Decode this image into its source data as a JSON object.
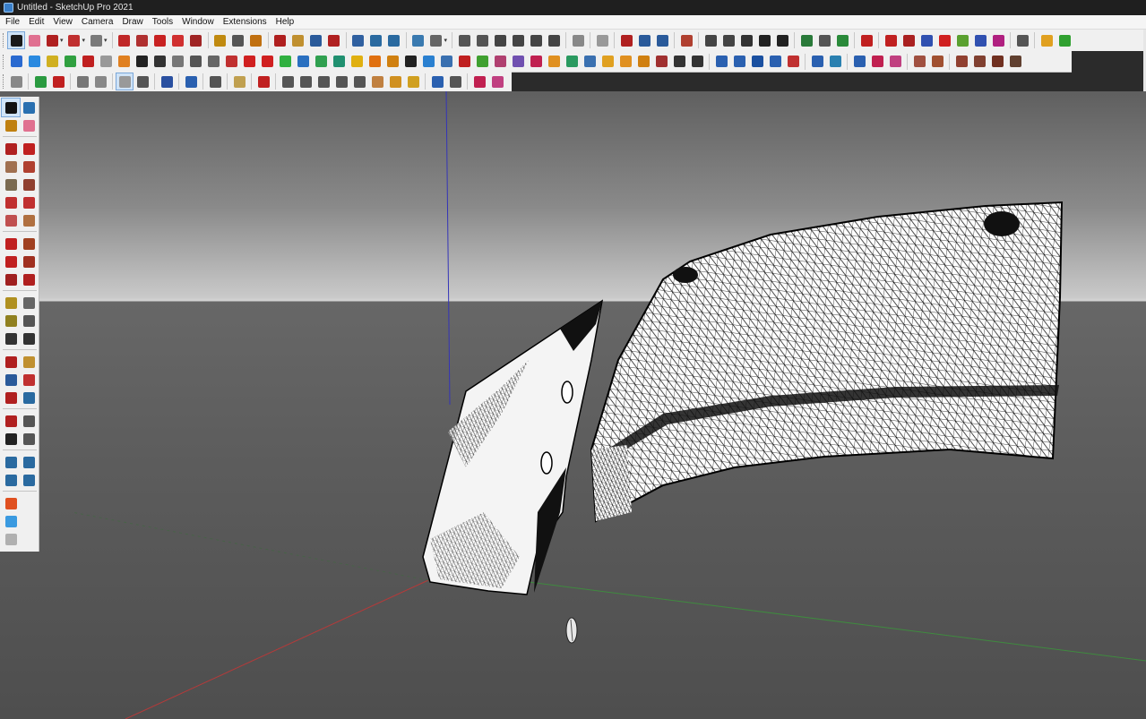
{
  "window": {
    "title": "Untitled - SketchUp Pro 2021"
  },
  "menu": [
    "File",
    "Edit",
    "View",
    "Camera",
    "Draw",
    "Tools",
    "Window",
    "Extensions",
    "Help"
  ],
  "colors": {
    "red_axis": "#b43a3a",
    "green_axis": "#3f8a3f",
    "blue_axis": "#3434b8",
    "selection": "#cfe3f7"
  },
  "toolbars": {
    "row1": [
      {
        "icon": "select-icon",
        "c": "#1a1a1a",
        "sel": true
      },
      {
        "icon": "eraser-icon",
        "c": "#e07090"
      },
      {
        "icon": "line-icon",
        "c": "#b02020",
        "drop": true
      },
      {
        "icon": "arc-icon",
        "c": "#c03030",
        "drop": true
      },
      {
        "icon": "circle-shape-icon",
        "c": "#7a7a7a",
        "drop": true
      },
      {
        "sep": true
      },
      {
        "icon": "move-icon",
        "c": "#c02828"
      },
      {
        "icon": "follow-me-icon",
        "c": "#b03030"
      },
      {
        "icon": "push-pull-icon",
        "c": "#c82222"
      },
      {
        "icon": "rotate-icon",
        "c": "#d03030"
      },
      {
        "icon": "scale-icon",
        "c": "#a02525"
      },
      {
        "sep": true
      },
      {
        "icon": "tape-measure-icon",
        "c": "#c08a10"
      },
      {
        "icon": "text-icon",
        "c": "#555"
      },
      {
        "icon": "paint-bucket-icon",
        "c": "#c07010"
      },
      {
        "sep": true
      },
      {
        "icon": "orbit-icon",
        "c": "#b02020"
      },
      {
        "icon": "pan-icon",
        "c": "#c09030"
      },
      {
        "icon": "zoom-icon",
        "c": "#2a5a9a"
      },
      {
        "icon": "zoom-extents-icon",
        "c": "#b02020"
      },
      {
        "sep": true
      },
      {
        "icon": "warehouse-icon",
        "c": "#3060a0"
      },
      {
        "icon": "extension-warehouse-icon",
        "c": "#2a6aa0"
      },
      {
        "icon": "share-model-icon",
        "c": "#2a6aa0"
      },
      {
        "sep": true
      },
      {
        "icon": "sandbox-icon",
        "c": "#3a7ab0"
      },
      {
        "icon": "search-icon",
        "c": "#666",
        "drop": true
      },
      {
        "sep": true
      },
      {
        "icon": "iso-view-icon",
        "c": "#555"
      },
      {
        "icon": "top-view-icon",
        "c": "#555"
      },
      {
        "icon": "front-view-icon",
        "c": "#444"
      },
      {
        "icon": "right-view-icon",
        "c": "#444"
      },
      {
        "icon": "back-view-icon",
        "c": "#444"
      },
      {
        "icon": "left-view-icon",
        "c": "#444"
      },
      {
        "sep": true
      },
      {
        "icon": "xray-icon",
        "c": "#888"
      },
      {
        "sep": true
      },
      {
        "icon": "back-edges-icon",
        "c": "#999"
      },
      {
        "sep": true
      },
      {
        "icon": "section-plane-icon",
        "c": "#b02020"
      },
      {
        "icon": "section-cut-icon",
        "c": "#2a5a9a"
      },
      {
        "icon": "section-fill-icon",
        "c": "#2a5a9a"
      },
      {
        "sep": true
      },
      {
        "icon": "component-icon",
        "c": "#b04030"
      },
      {
        "sep": true
      },
      {
        "icon": "person-icon",
        "c": "#444"
      },
      {
        "icon": "person-walk-icon",
        "c": "#444"
      },
      {
        "icon": "camera-icon",
        "c": "#333"
      },
      {
        "icon": "fog-icon",
        "c": "#222"
      },
      {
        "icon": "gear-icon",
        "c": "#222"
      },
      {
        "sep": true
      },
      {
        "icon": "geo-location-icon",
        "c": "#2a7a3a"
      },
      {
        "icon": "report-icon",
        "c": "#555"
      },
      {
        "icon": "link-icon",
        "c": "#2a8a3a"
      },
      {
        "sep": true
      },
      {
        "icon": "undo-icon",
        "c": "#c02020"
      },
      {
        "sep": true
      },
      {
        "icon": "solid-union-icon",
        "c": "#c02020"
      },
      {
        "icon": "solid-subtract-icon",
        "c": "#aa2020"
      },
      {
        "icon": "solid-intersect-icon",
        "c": "#3050b0"
      },
      {
        "icon": "solid-trim-icon",
        "c": "#d02020"
      },
      {
        "icon": "solid-split-icon",
        "c": "#5aa030"
      },
      {
        "icon": "solid-shell-icon",
        "c": "#3050b0"
      },
      {
        "icon": "solid-outer-icon",
        "c": "#b02080"
      },
      {
        "sep": true
      },
      {
        "icon": "curviloft-icon",
        "c": "#555"
      },
      {
        "sep": true
      },
      {
        "icon": "shirt-icon",
        "c": "#e0a020"
      },
      {
        "icon": "shirt-green-icon",
        "c": "#30a030"
      }
    ],
    "row2": [
      {
        "icon": "tool-blue-1-icon",
        "c": "#2a6ad0"
      },
      {
        "icon": "tool-blue-2-icon",
        "c": "#2a8ae0"
      },
      {
        "icon": "tool-yellow-1-icon",
        "c": "#d0b020"
      },
      {
        "icon": "tool-green-1-icon",
        "c": "#30a040"
      },
      {
        "icon": "tool-red-1-icon",
        "c": "#c02020"
      },
      {
        "icon": "tool-outline-icon",
        "c": "#999"
      },
      {
        "icon": "tool-orange-icon",
        "c": "#e08020"
      },
      {
        "icon": "tool-black-1-icon",
        "c": "#222"
      },
      {
        "icon": "tool-black-2-icon",
        "c": "#333"
      },
      {
        "icon": "tool-flag-icon",
        "c": "#777"
      },
      {
        "icon": "tool-curve-1-icon",
        "c": "#555"
      },
      {
        "icon": "tool-curve-2-icon",
        "c": "#666"
      },
      {
        "icon": "tool-curve-3-icon",
        "c": "#c03030"
      },
      {
        "icon": "tool-red-2-icon",
        "c": "#d02020"
      },
      {
        "icon": "tool-cross-icon",
        "c": "#d02020"
      },
      {
        "icon": "tool-green-2-icon",
        "c": "#30b040"
      },
      {
        "icon": "tool-blue-3-icon",
        "c": "#2a70c0"
      },
      {
        "icon": "tool-green-3-icon",
        "c": "#30a050"
      },
      {
        "icon": "tool-teal-icon",
        "c": "#209070"
      },
      {
        "icon": "tool-warning-icon",
        "c": "#e0b010"
      },
      {
        "icon": "tool-orange-2-icon",
        "c": "#e07010"
      },
      {
        "icon": "tool-orange-3-icon",
        "c": "#d08010"
      },
      {
        "icon": "tool-black-3-icon",
        "c": "#222"
      },
      {
        "icon": "tool-blue-4-icon",
        "c": "#2a80d0"
      },
      {
        "icon": "tool-blue-5-icon",
        "c": "#3a70b0"
      },
      {
        "icon": "tool-red-3-icon",
        "c": "#c02020"
      },
      {
        "icon": "tool-green-4-icon",
        "c": "#40a030"
      },
      {
        "icon": "tool-multi-1-icon",
        "c": "#b04070"
      },
      {
        "icon": "tool-multi-2-icon",
        "c": "#7050b0"
      },
      {
        "icon": "tool-red-4-icon",
        "c": "#c02050"
      },
      {
        "icon": "tool-orange-4-icon",
        "c": "#e09020"
      },
      {
        "icon": "tool-green-5-icon",
        "c": "#2a9a60"
      },
      {
        "icon": "tool-box-icon",
        "c": "#3a70b0"
      },
      {
        "icon": "tool-grid-1-icon",
        "c": "#e0a020"
      },
      {
        "icon": "tool-grid-2-icon",
        "c": "#e09020"
      },
      {
        "icon": "tool-grid-3-icon",
        "c": "#d08010"
      },
      {
        "icon": "tool-scatter-icon",
        "c": "#a03030"
      },
      {
        "icon": "tool-spin-icon",
        "c": "#333"
      },
      {
        "icon": "tool-fork-icon",
        "c": "#333"
      },
      {
        "sep": true
      },
      {
        "icon": "tool-blue-6-icon",
        "c": "#2a60b0"
      },
      {
        "icon": "tool-blue-7-icon",
        "c": "#2a60b0"
      },
      {
        "icon": "tool-blue-8-icon",
        "c": "#1a50a0"
      },
      {
        "icon": "tool-pair-1-icon",
        "c": "#2a60b0"
      },
      {
        "icon": "tool-pair-2-icon",
        "c": "#c03030"
      },
      {
        "sep": true
      },
      {
        "icon": "tool-diag-icon",
        "c": "#2a60b0"
      },
      {
        "icon": "tool-frame-icon",
        "c": "#2a80b0"
      },
      {
        "sep": true
      },
      {
        "icon": "tool-hook-1-icon",
        "c": "#2a60b0"
      },
      {
        "icon": "tool-hook-2-icon",
        "c": "#c02050"
      },
      {
        "icon": "tool-pink-icon",
        "c": "#c04080"
      },
      {
        "sep": true
      },
      {
        "icon": "tool-brown-1-icon",
        "c": "#a05040"
      },
      {
        "icon": "tool-brown-2-icon",
        "c": "#a05030"
      },
      {
        "sep": true
      },
      {
        "icon": "tool-brown-3-icon",
        "c": "#904030"
      },
      {
        "icon": "tool-brown-4-icon",
        "c": "#804030"
      },
      {
        "icon": "tool-brown-5-icon",
        "c": "#703020"
      },
      {
        "icon": "tool-brown-6-icon",
        "c": "#604030"
      }
    ],
    "row3": [
      {
        "icon": "tool-outline-2-icon",
        "c": "#888"
      },
      {
        "sep": true
      },
      {
        "icon": "tool-green-6-icon",
        "c": "#2a9a40"
      },
      {
        "icon": "tool-red-5-icon",
        "c": "#c02020"
      },
      {
        "sep": true
      },
      {
        "icon": "tool-tag-1-icon",
        "c": "#777"
      },
      {
        "icon": "tool-tag-2-icon",
        "c": "#888"
      },
      {
        "sep": true
      },
      {
        "icon": "tool-circle-sel-icon",
        "c": "#999",
        "sel": true
      },
      {
        "icon": "tool-bar-icon",
        "c": "#555"
      },
      {
        "sep": true
      },
      {
        "icon": "tool-blue-9-icon",
        "c": "#2a50a0"
      },
      {
        "sep": true
      },
      {
        "icon": "tool-chart-icon",
        "c": "#2a60b0"
      },
      {
        "sep": true
      },
      {
        "icon": "tool-stairs-icon",
        "c": "#555"
      },
      {
        "sep": true
      },
      {
        "icon": "tool-arc-1-icon",
        "c": "#c0a050"
      },
      {
        "sep": true
      },
      {
        "icon": "tool-pen-icon",
        "c": "#c02020"
      },
      {
        "sep": true
      },
      {
        "icon": "tool-dome-1-icon",
        "c": "#555"
      },
      {
        "icon": "tool-dome-2-icon",
        "c": "#555"
      },
      {
        "icon": "tool-dome-3-icon",
        "c": "#555"
      },
      {
        "icon": "tool-dome-4-icon",
        "c": "#555"
      },
      {
        "icon": "tool-dome-5-icon",
        "c": "#555"
      },
      {
        "icon": "tool-dome-6-icon",
        "c": "#c08040"
      },
      {
        "icon": "tool-dome-7-icon",
        "c": "#d09020"
      },
      {
        "icon": "tool-dome-8-icon",
        "c": "#d0a020"
      },
      {
        "sep": true
      },
      {
        "icon": "tool-flag-2-icon",
        "c": "#2a60b0"
      },
      {
        "icon": "tool-flag-3-icon",
        "c": "#555"
      },
      {
        "sep": true
      },
      {
        "icon": "tool-paint-1-icon",
        "c": "#c02050"
      },
      {
        "icon": "tool-paint-2-icon",
        "c": "#c04080"
      }
    ]
  },
  "left_toolbar": [
    [
      {
        "icon": "select-icon",
        "c": "#111",
        "sel": true
      },
      {
        "icon": "component-icon",
        "c": "#2a70b0"
      }
    ],
    [
      {
        "icon": "paint-bucket-icon",
        "c": "#c08010"
      },
      {
        "icon": "eraser-icon",
        "c": "#e07090"
      }
    ],
    null,
    [
      {
        "icon": "line-icon",
        "c": "#b02020"
      },
      {
        "icon": "freehand-icon",
        "c": "#c02020"
      }
    ],
    [
      {
        "icon": "rectangle-icon",
        "c": "#a07050"
      },
      {
        "icon": "rotated-rectangle-icon",
        "c": "#b04030"
      }
    ],
    [
      {
        "icon": "circle-icon",
        "c": "#7a6a50"
      },
      {
        "icon": "polygon-icon",
        "c": "#904030"
      }
    ],
    [
      {
        "icon": "arc-icon",
        "c": "#c03030"
      },
      {
        "icon": "two-point-arc-icon",
        "c": "#c03030"
      }
    ],
    [
      {
        "icon": "three-point-arc-icon",
        "c": "#c05050"
      },
      {
        "icon": "pie-icon",
        "c": "#b07040"
      }
    ],
    null,
    [
      {
        "icon": "move-icon",
        "c": "#c02020"
      },
      {
        "icon": "push-pull-icon",
        "c": "#a04020"
      }
    ],
    [
      {
        "icon": "rotate-icon",
        "c": "#c02020"
      },
      {
        "icon": "follow-me-icon",
        "c": "#a03020"
      }
    ],
    [
      {
        "icon": "scale-icon",
        "c": "#a02020"
      },
      {
        "icon": "offset-icon",
        "c": "#b02020"
      }
    ],
    null,
    [
      {
        "icon": "tape-measure-icon",
        "c": "#b09020"
      },
      {
        "icon": "dimension-icon",
        "c": "#666"
      }
    ],
    [
      {
        "icon": "protractor-icon",
        "c": "#908020"
      },
      {
        "icon": "text-icon",
        "c": "#555"
      }
    ],
    [
      {
        "icon": "axes-icon",
        "c": "#333"
      },
      {
        "icon": "3d-text-icon",
        "c": "#333"
      }
    ],
    null,
    [
      {
        "icon": "orbit-icon",
        "c": "#b02020"
      },
      {
        "icon": "pan-icon",
        "c": "#c09030"
      }
    ],
    [
      {
        "icon": "zoom-icon",
        "c": "#2a5a9a"
      },
      {
        "icon": "zoom-window-icon",
        "c": "#c03030"
      }
    ],
    [
      {
        "icon": "zoom-extents-icon",
        "c": "#b02020"
      },
      {
        "icon": "previous-view-icon",
        "c": "#2a6aa0"
      }
    ],
    null,
    [
      {
        "icon": "position-camera-icon",
        "c": "#b02020"
      },
      {
        "icon": "look-around-icon",
        "c": "#555"
      }
    ],
    [
      {
        "icon": "walk-icon",
        "c": "#222"
      },
      {
        "icon": "section-plane-icon",
        "c": "#555"
      }
    ],
    null,
    [
      {
        "icon": "warehouse-icon",
        "c": "#2a6aa0"
      },
      {
        "icon": "extension-warehouse-icon",
        "c": "#2a6aa0"
      }
    ],
    [
      {
        "icon": "share-model-icon",
        "c": "#2a6aa0"
      },
      {
        "icon": "extension-manager-icon",
        "c": "#2a6aa0"
      }
    ],
    null,
    [
      {
        "icon": "ruby-cube-red-icon",
        "c": "#e05020"
      }
    ],
    [
      {
        "icon": "ruby-cube-blue-icon",
        "c": "#3a9ae0"
      }
    ],
    [
      {
        "icon": "ruby-cube-grey-icon",
        "c": "#b0b0b0"
      }
    ]
  ]
}
